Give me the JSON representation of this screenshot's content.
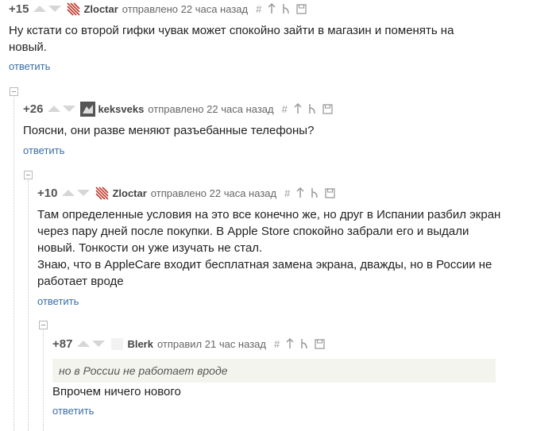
{
  "comments": [
    {
      "rating": "+15",
      "author": "Zloctar",
      "meta": "отправлено 22 часа назад",
      "text": [
        "Ну кстати со второй гифки чувак может спокойно зайти в магазин и поменять на новый."
      ],
      "reply_label": "ответить"
    },
    {
      "rating": "+26",
      "author": "keksveks",
      "meta": "отправлено 22 часа назад",
      "text": [
        "Поясни, они разве меняют разъебанные телефоны?"
      ],
      "reply_label": "ответить"
    },
    {
      "rating": "+10",
      "author": "Zloctar",
      "meta": "отправлено 22 часа назад",
      "text": [
        "Там определенные условия на это все конечно же, но друг в Испании разбил экран через пару дней после покупки. В Apple Store спокойно забрали его и выдали новый. Тонкости он уже изучать не стал.",
        "Знаю, что в AppleCare входит бесплатная замена экрана, дважды, но в России не работает вроде"
      ],
      "reply_label": "ответить"
    },
    {
      "rating": "+87",
      "author": "Blerk",
      "meta": "отправил 21 час назад",
      "quote": "но в России не работает вроде",
      "text": [
        "Впрочем ничего нового"
      ],
      "reply_label": "ответить"
    }
  ],
  "icons": {
    "tool_hash": "#",
    "colors": {
      "link": "#3a6ea5",
      "zloctar_avatar": "#c0392b",
      "vote_arrow": "#d6d6d6"
    }
  }
}
